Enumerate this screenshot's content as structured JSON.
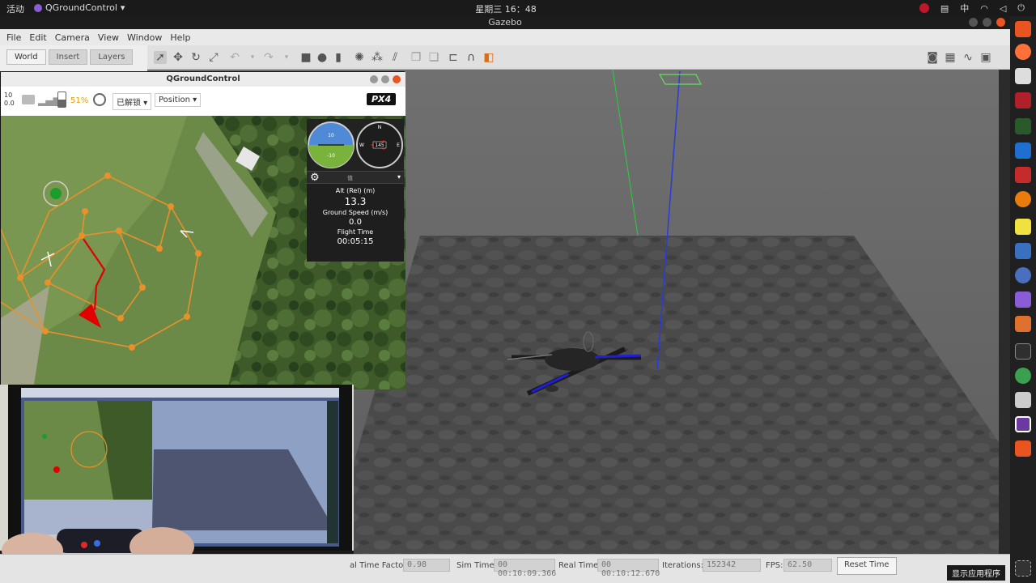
{
  "topbar": {
    "activities": "活动",
    "app_name": "QGroundControl",
    "clock": "星期三 16：48",
    "input_method": "中"
  },
  "gazebo": {
    "window_title": "Gazebo",
    "menu": [
      "File",
      "Edit",
      "Camera",
      "View",
      "Window",
      "Help"
    ],
    "tabs": [
      "World",
      "Insert",
      "Layers"
    ],
    "active_tab": "World",
    "status": {
      "real_time_factor_label": "al Time Factor:",
      "real_time_factor": "0.98",
      "sim_time_label": "Sim Time:",
      "sim_time": "00 00:10:09.366",
      "real_time_label": "Real Time:",
      "real_time": "00 00:10:12.670",
      "iterations_label": "Iterations:",
      "iterations": "152342",
      "fps_label": "FPS:",
      "fps": "62.50",
      "reset_label": "Reset Time"
    }
  },
  "qgc": {
    "window_title": "QGroundControl",
    "battery": "51%",
    "arm_state": "已解锁",
    "flight_mode": "Position",
    "logo": "PX4",
    "sats": "10",
    "hdop": "0.0",
    "instruments": {
      "heading": "145",
      "compass_n": "N",
      "compass_e": "E",
      "compass_w": "W",
      "ticks_up": "10",
      "ticks_down": "-10"
    },
    "values": [
      {
        "label": "Alt (Rel) (m)",
        "value": "13.3"
      },
      {
        "label": "Ground Speed (m/s)",
        "value": "0.0"
      },
      {
        "label": "Flight Time",
        "value": "00:05:15"
      }
    ],
    "values_header": "值"
  },
  "dock": {
    "show_apps": "显示应用程序"
  },
  "colors": {
    "ubuntu_orange": "#e95420",
    "mission_path": "#e8912a",
    "vehicle_track": "#e00000",
    "z_axis": "#2a3bd8",
    "y_axis": "#27d13d",
    "waypoint_home": "#1c9c2a"
  }
}
